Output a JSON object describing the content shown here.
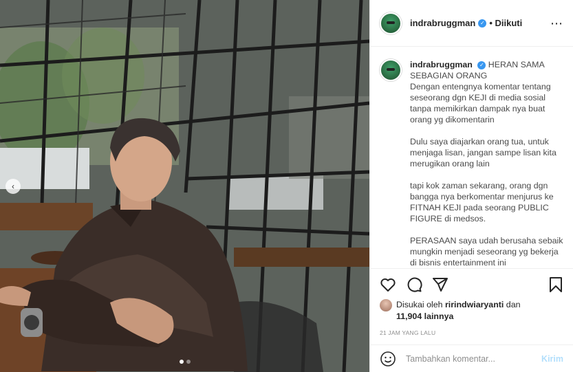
{
  "post": {
    "username": "indrabruggman",
    "follow_status": "• Diikuti",
    "caption_paragraphs": [
      "HERAN SAMA SEBAGIAN ORANG\nDengan entengnya komentar tentang seseorang dgn KEJI di media sosial tanpa memikirkan dampak nya buat orang yg dikomentarin",
      "Dulu saya diajarkan orang tua, untuk menjaga lisan, jangan sampe lisan kita merugikan orang lain",
      "tapi kok zaman sekarang, orang dgn bangga nya berkomentar menjurus ke FITNAH KEJI pada seorang PUBLIC FIGURE di medsos.",
      "PERASAAN saya udah berusaha sebaik mungkin menjadi seseorang yg bekerja di bisnis entertainment ini"
    ],
    "likes_prefix": "Disukai oleh",
    "likes_user": "ririndwiaryanti",
    "likes_conjunction": "dan",
    "likes_count": "11,904 lainnya",
    "timestamp": "21 JAM YANG LALU"
  },
  "comment": {
    "placeholder": "Tambahkan komentar...",
    "post_label": "Kirim"
  },
  "carousel": {
    "prev_icon": "‹",
    "slides": 2,
    "active": 0
  },
  "icons": {
    "more": "⋯",
    "verified": "✓",
    "like": "heart-icon",
    "comment": "comment-icon",
    "share": "share-icon",
    "save": "bookmark-icon",
    "emoji": "smiley-icon"
  },
  "colors": {
    "verified": "#3897f0",
    "post_button_disabled": "#b2dffc"
  }
}
